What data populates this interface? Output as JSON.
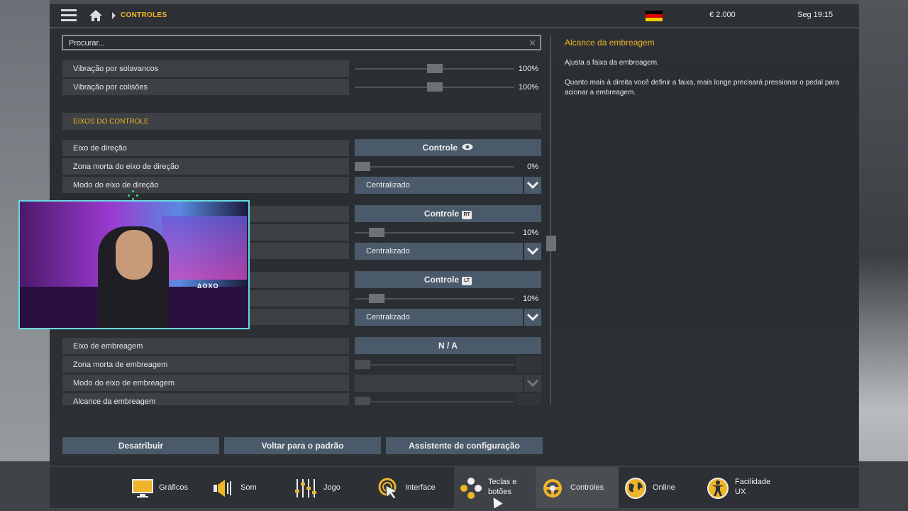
{
  "topbar": {
    "breadcrumb": "CONTROLES",
    "money": "€ 2.000",
    "time": "Seg 19:15"
  },
  "search": {
    "placeholder": "Procurar..."
  },
  "rows": {
    "vib_bumps": {
      "label": "Vibração por solavancos",
      "value": "100%",
      "level_percent": 50
    },
    "vib_collisions": {
      "label": "Vibração por colisões",
      "value": "100%",
      "level_percent": 50
    },
    "section_axes": "EIXOS DO CONTROLE",
    "steer_axis": {
      "label": "Eixo de direção",
      "button": "Controle"
    },
    "steer_deadzone": {
      "label": "Zona morta do eixo de direção",
      "value": "0%",
      "level_percent": 0
    },
    "steer_mode": {
      "label": "Modo do eixo de direção",
      "value": "Centralizado"
    },
    "throttle_axis": {
      "button": "Controle",
      "badge": "RT"
    },
    "throttle_deadzone": {
      "value": "10%",
      "level_percent": 10
    },
    "throttle_mode": {
      "value": "Centralizado"
    },
    "brake_axis": {
      "button": "Controle",
      "badge": "LT"
    },
    "brake_deadzone": {
      "value": "10%",
      "level_percent": 10
    },
    "brake_mode": {
      "value": "Centralizado"
    },
    "clutch_axis": {
      "label": "Eixo de embreagem",
      "button": "N / A"
    },
    "clutch_deadzone": {
      "label": "Zona morta de embreagem",
      "level_percent": 0
    },
    "clutch_mode": {
      "label": "Modo do eixo de embreagem"
    },
    "clutch_range": {
      "label": "Alcance da embreagem",
      "level_percent": 0
    }
  },
  "actions": {
    "unassign": "Desatribuir",
    "reset": "Voltar para o padrão",
    "wizard": "Assistente de configuração"
  },
  "info": {
    "title": "Alcance da embreagem",
    "p1": "Ajusta a faixa da embreagem.",
    "p2": "Quanto mais à direita você definir a faixa, mais longe precisará pressionar o pedal para acionar a embreagem."
  },
  "webcam": {
    "logo_text": "ΔOXO"
  },
  "bottom_tabs": [
    {
      "label": "Gráficos",
      "icon": "monitor-icon"
    },
    {
      "label": "Som",
      "icon": "speaker-icon"
    },
    {
      "label": "Jogo",
      "icon": "sliders-icon"
    },
    {
      "label": "Interface",
      "icon": "cursor-target-icon"
    },
    {
      "label_line1": "Teclas e",
      "label_line2": "botões",
      "icon": "gamepad-buttons-icon"
    },
    {
      "label": "Controles",
      "icon": "steering-wheel-icon",
      "active": true
    },
    {
      "label": "Online",
      "icon": "globe-icon"
    },
    {
      "label_line1": "Facilidade",
      "label_line2": "UX",
      "icon": "accessibility-icon"
    }
  ],
  "colors": {
    "accent": "#f0b429",
    "button": "#4a5a6a",
    "panel": "#3d4044"
  }
}
